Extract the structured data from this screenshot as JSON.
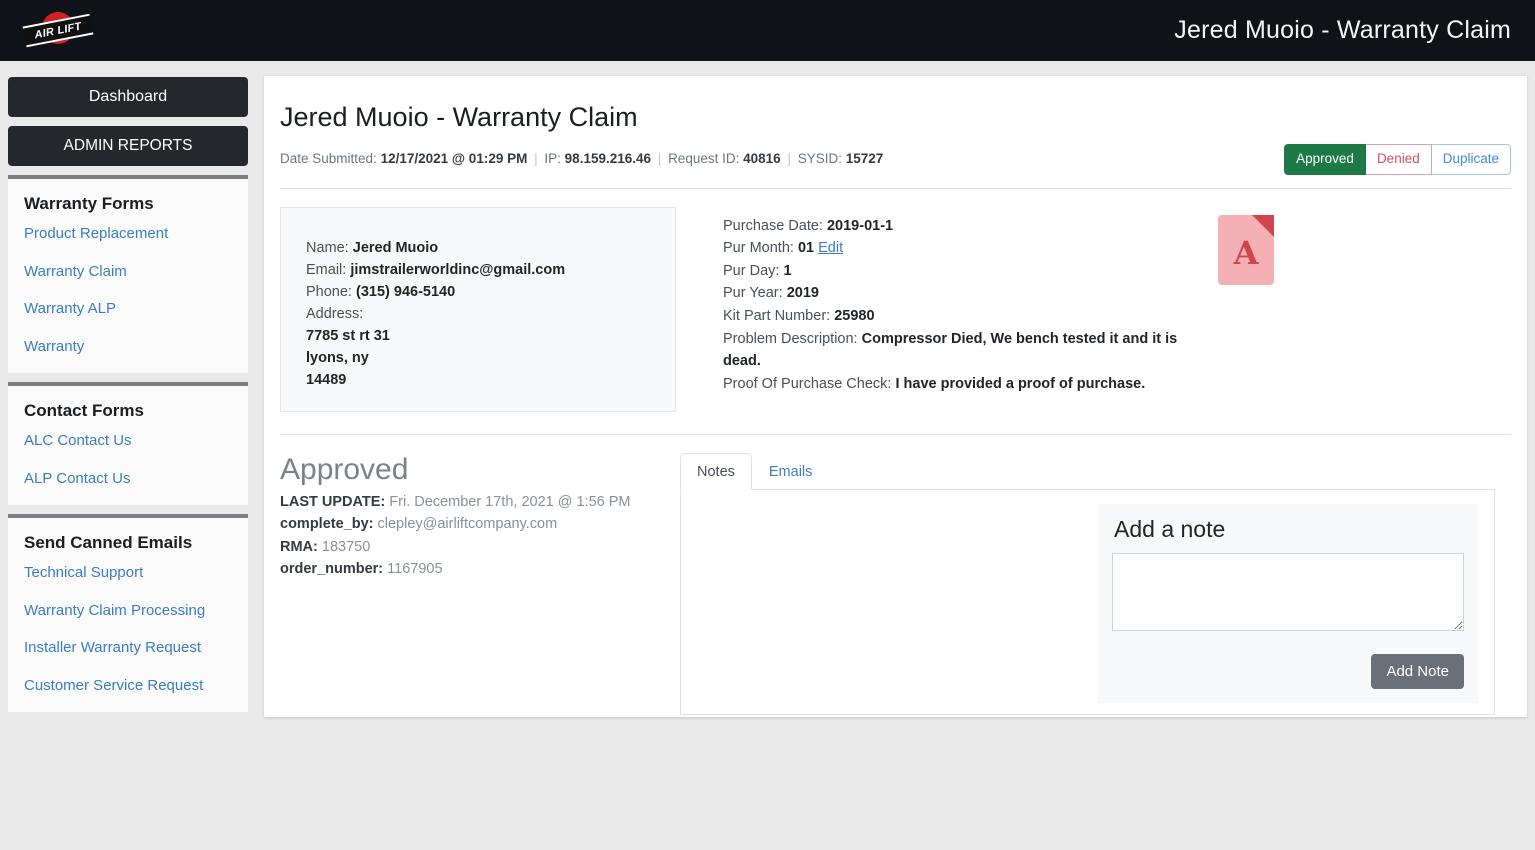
{
  "topbar": {
    "logo_text": "AIR LIFT",
    "logo_icon": "airlift-logo",
    "title": "Jered Muoio - Warranty Claim"
  },
  "sidebar": {
    "buttons": [
      {
        "label": "Dashboard"
      },
      {
        "label": "ADMIN REPORTS"
      }
    ],
    "panels": [
      {
        "title": "Warranty Forms",
        "links": [
          "Product Replacement",
          "Warranty Claim",
          "Warranty ALP",
          "Warranty"
        ]
      },
      {
        "title": "Contact Forms",
        "links": [
          "ALC Contact Us",
          "ALP Contact Us"
        ]
      },
      {
        "title": "Send Canned Emails",
        "links": [
          "Technical Support",
          "Warranty Claim Processing",
          "Installer Warranty Request",
          "Customer Service Request"
        ]
      }
    ]
  },
  "main": {
    "page_title": "Jered Muoio - Warranty Claim",
    "meta": {
      "date_label": "Date Submitted:",
      "date_value": "12/17/2021 @ 01:29 PM",
      "ip_label": "IP:",
      "ip_value": "98.159.216.46",
      "request_label": "Request ID:",
      "request_value": "40816",
      "sysid_label": "SYSID:",
      "sysid_value": "15727",
      "separator": "|"
    },
    "status_buttons": [
      {
        "label": "Approved",
        "state": "active",
        "color": "#1d7a46"
      },
      {
        "label": "Denied",
        "state": "inactive",
        "color": "#d2535c"
      },
      {
        "label": "Duplicate",
        "state": "inactive",
        "color": "#3c8dd9"
      }
    ],
    "customer": {
      "name_label": "Name:",
      "name_value": "Jered Muoio",
      "email_label": "Email:",
      "email_value": "jimstrailerworldinc@gmail.com",
      "phone_label": "Phone:",
      "phone_value": "(315) 946-5140",
      "address_label": "Address:",
      "address_lines": [
        "7785 st rt 31",
        "lyons, ny",
        "14489"
      ]
    },
    "purchase": {
      "purchase_date_label": "Purchase Date:",
      "purchase_date_value": "2019-01-1",
      "pur_month_label": "Pur Month:",
      "pur_month_value": "01",
      "edit_link": "Edit",
      "pur_day_label": "Pur Day:",
      "pur_day_value": "1",
      "pur_year_label": "Pur Year:",
      "pur_year_value": "2019",
      "kit_part_label": "Kit Part Number:",
      "kit_part_value": "25980",
      "problem_label": "Problem Description:",
      "problem_value": "Compressor Died, We bench tested it and it is dead.",
      "proof_label": "Proof Of Purchase Check:",
      "proof_value": "I have provided a proof of purchase."
    },
    "attachment": {
      "icon": "pdf-file-icon",
      "glyph": "A"
    },
    "status": {
      "heading": "Approved",
      "last_update_label": "LAST UPDATE:",
      "last_update_value": "Fri. December 17th, 2021 @ 1:56 PM",
      "complete_by_label": "complete_by:",
      "complete_by_value": "clepley@airliftcompany.com",
      "rma_label": "RMA:",
      "rma_value": "183750",
      "order_number_label": "order_number:",
      "order_number_value": "1167905"
    },
    "tabs": [
      {
        "label": "Notes",
        "active": true
      },
      {
        "label": "Emails",
        "active": false
      }
    ],
    "note_form": {
      "title": "Add a note",
      "textarea_value": "",
      "textarea_placeholder": "",
      "submit_label": "Add Note"
    }
  }
}
